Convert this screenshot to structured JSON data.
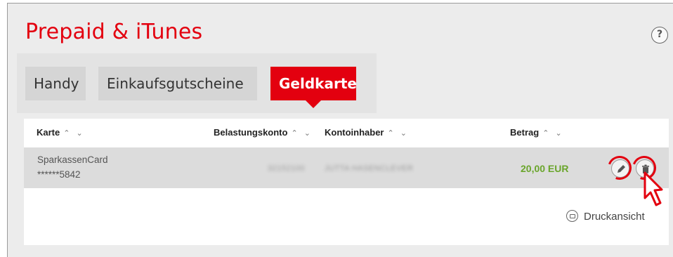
{
  "page": {
    "title": "Prepaid & iTunes",
    "help_label": "?"
  },
  "tabs": [
    {
      "label": "Handy",
      "active": false
    },
    {
      "label": "Einkaufsgutscheine",
      "active": false
    },
    {
      "label": "Geldkarte",
      "active": true
    }
  ],
  "table": {
    "columns": [
      {
        "label": "Karte",
        "sort": "^ v"
      },
      {
        "label": "Belastungskonto",
        "sort": "^ v"
      },
      {
        "label": "Kontoinhaber",
        "sort": "^ v"
      },
      {
        "label": "Betrag",
        "sort": "^ v"
      }
    ],
    "rows": [
      {
        "card_name": "SparkassenCard",
        "card_number": "******5842",
        "account": "32152100",
        "holder": "JUTTA HASENCLEVER",
        "amount": "20,00 EUR"
      }
    ]
  },
  "actions": {
    "edit_icon": "pencil-icon",
    "delete_icon": "trash-icon"
  },
  "footer": {
    "print_label": "Druckansicht"
  },
  "colors": {
    "brand": "#e3000f",
    "amount": "#6aa52b"
  }
}
